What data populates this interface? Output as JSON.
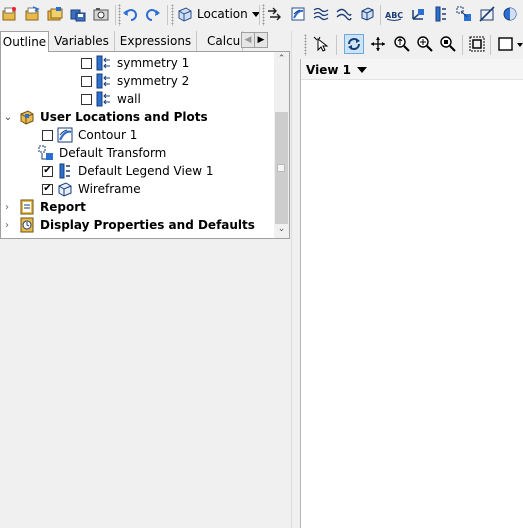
{
  "toolbar": {
    "location_label": "Location",
    "icons_left": [
      "new-file-icon",
      "open-file-icon",
      "open-folder-icon",
      "save-icon",
      "camera-icon"
    ],
    "icons_history": [
      "undo-icon",
      "redo-icon"
    ],
    "icons_right": [
      "vector-icon",
      "contour-icon",
      "streamline-icon",
      "particle-track-icon",
      "volume-render-icon",
      "text-icon",
      "coordinate-frame-icon",
      "legend-icon",
      "instance-transform-icon",
      "clip-plane-icon",
      "color-map-icon"
    ]
  },
  "tabs": [
    {
      "label": "Outline",
      "active": true
    },
    {
      "label": "Variables",
      "active": false
    },
    {
      "label": "Expressions",
      "active": false
    },
    {
      "label": "Calcula",
      "active": false
    }
  ],
  "tree": {
    "items": [
      {
        "label": "symmetry 1",
        "checked": false,
        "icon": "boundary-icon"
      },
      {
        "label": "symmetry 2",
        "checked": false,
        "icon": "boundary-icon"
      },
      {
        "label": "wall",
        "checked": false,
        "icon": "boundary-icon"
      },
      {
        "label": "User Locations and Plots",
        "bold": true,
        "expanded": true,
        "icon": "user-locations-icon"
      },
      {
        "label": "Contour 1",
        "checked": false,
        "icon": "contour-icon"
      },
      {
        "label": "Default Transform",
        "icon": "transform-icon"
      },
      {
        "label": "Default Legend View 1",
        "checked": true,
        "icon": "legend-icon"
      },
      {
        "label": "Wireframe",
        "checked": true,
        "icon": "wireframe-icon"
      },
      {
        "label": "Report",
        "bold": true,
        "expanded": false,
        "icon": "report-icon"
      },
      {
        "label": "Display Properties and Defaults",
        "bold": true,
        "expanded": false,
        "icon": "display-properties-icon"
      }
    ]
  },
  "viewer": {
    "title": "View 1",
    "toolbar_icons": [
      "select-icon",
      "rotate-icon",
      "pan-icon",
      "zoom-icon",
      "zoom-box-icon",
      "zoom-fit-icon",
      "probe-icon",
      "viewport-layout-icon"
    ]
  },
  "colors": {
    "background": "#f0f0f0",
    "panel": "#ffffff",
    "accent_blue": "#2a6fd1",
    "selection": "#cce4f7"
  }
}
